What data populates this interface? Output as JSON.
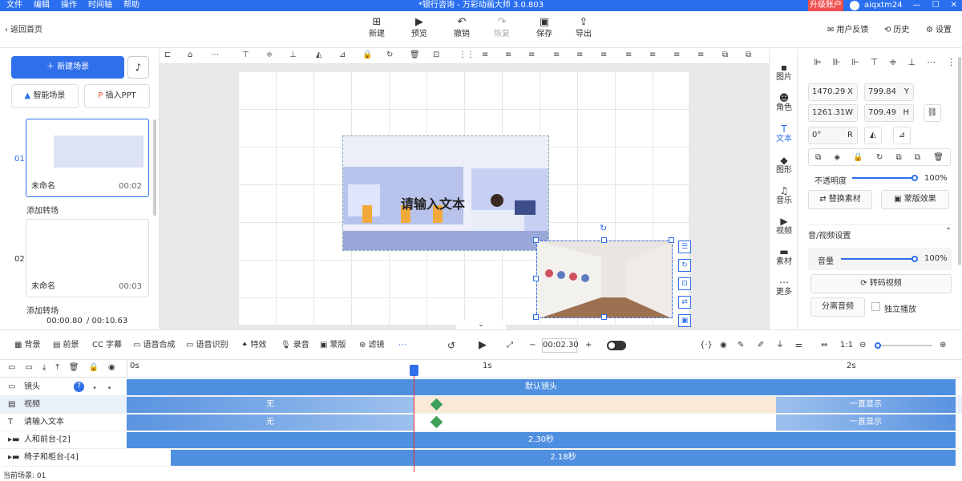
{
  "app": {
    "title": "*银行咨询 - 万彩动画大师 3.0.803",
    "menu": [
      "文件",
      "编辑",
      "操作",
      "时间轴",
      "帮助"
    ],
    "upgrade": "升级账户",
    "username": "aiqxtm24"
  },
  "toolbar": {
    "back": "返回首页",
    "new": "新建",
    "preview": "预览",
    "undo": "撤销",
    "redo": "恢复",
    "save": "保存",
    "export": "导出",
    "feedback": "用户反馈",
    "history": "历史",
    "settings": "设置"
  },
  "left": {
    "new_scene": "新建场景",
    "smart_scene": "智能场景",
    "insert_ppt": "插入PPT",
    "scenes": [
      {
        "index": "01",
        "name": "未命名",
        "time": "00:02",
        "transition": "添加转场"
      },
      {
        "index": "02",
        "name": "未命名",
        "time": "00:03",
        "transition": "添加转场"
      }
    ],
    "time_current": "00:00.80",
    "time_total": "/ 00:10.63"
  },
  "canvas": {
    "text": "请输入文本"
  },
  "right_tabs": [
    "图片",
    "角色",
    "文本",
    "图形",
    "音乐",
    "视频",
    "素材",
    "更多"
  ],
  "props": {
    "x": "1470.29",
    "x_unit": "X",
    "y": "799.84",
    "y_unit": "Y",
    "w": "1261.31",
    "w_unit": "W",
    "h": "709.49",
    "h_unit": "H",
    "r": "0°",
    "r_unit": "R",
    "opacity_label": "不透明度",
    "opacity_value": "100%",
    "replace": "替换素材",
    "mask": "蒙版效果",
    "av_title": "音/视频设置",
    "volume_label": "音量",
    "volume_value": "100%",
    "transcode": "转码视频",
    "separate_audio": "分离音频",
    "independent_play": "独立播放"
  },
  "timeline_tools": {
    "bg": "背景",
    "fg": "前景",
    "caption": "字幕",
    "tts": "语音合成",
    "asr": "语音识别",
    "effects": "特效",
    "record": "录音",
    "mask": "蒙版",
    "filter": "滤镜",
    "timecode": "00:02.30"
  },
  "ruler": [
    "0s",
    "1s",
    "2s"
  ],
  "tracks": [
    {
      "name": "镜头",
      "bar": "默认镜头"
    },
    {
      "name": "视频",
      "left": "无",
      "right": "一直显示"
    },
    {
      "name": "请输入文本",
      "left": "无",
      "right": "一直显示"
    },
    {
      "name": "人和前台-[2]",
      "bar": "2.30秒"
    },
    {
      "name": "椅子和柜台-[4]",
      "bar": "2.18秒"
    }
  ],
  "status": "当前场景: 01"
}
